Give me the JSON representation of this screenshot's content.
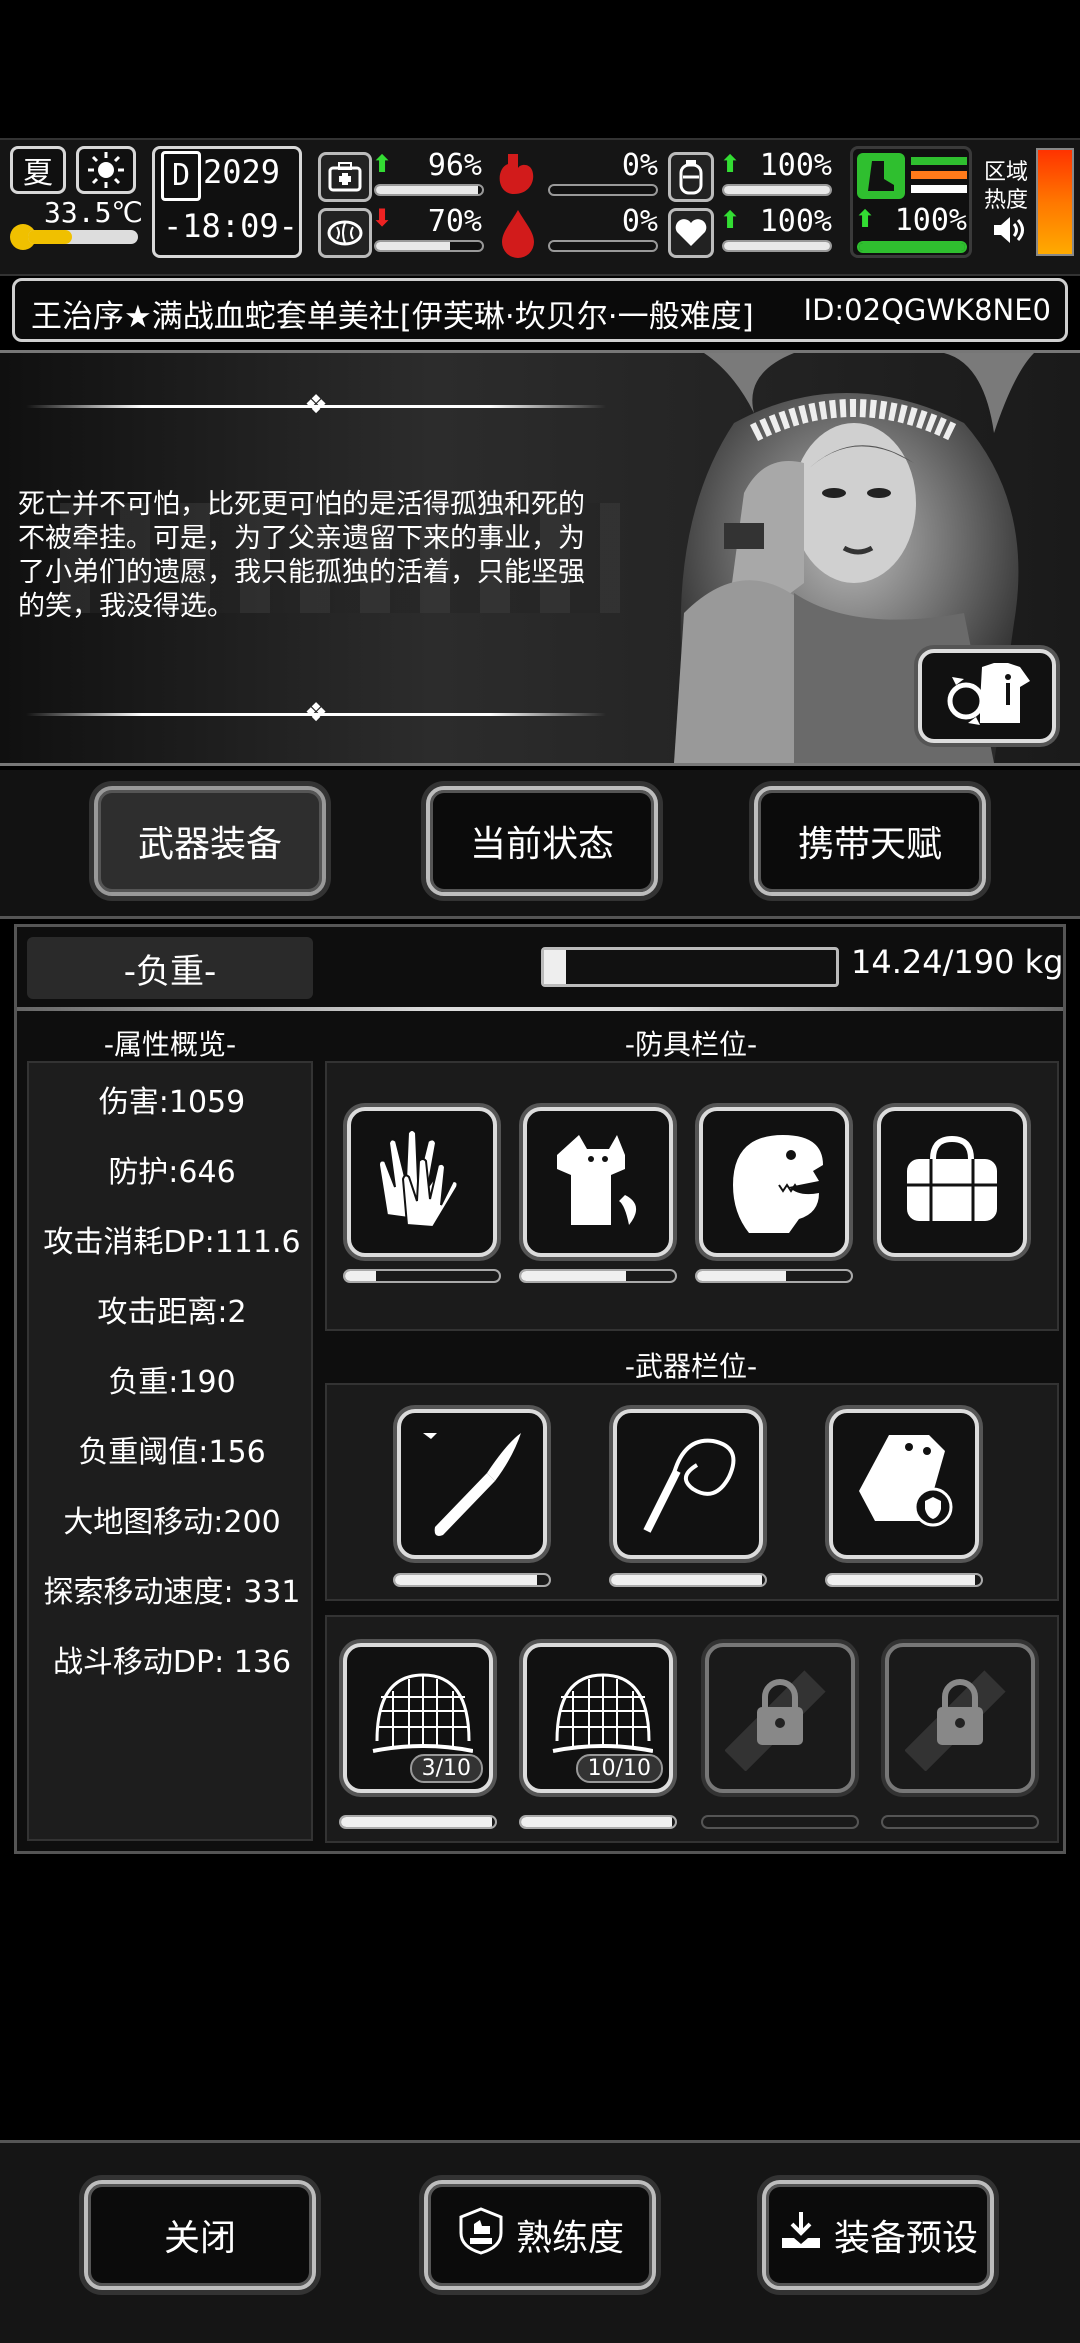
{
  "hud": {
    "season": "夏",
    "temperature": "33.5℃",
    "day_prefix": "D",
    "day": "2029",
    "time": "-18:09-",
    "health": {
      "icon": "medkit-icon",
      "trend": "up",
      "value": "96%",
      "fill": 0.96
    },
    "stomach": {
      "icon": "stomach-icon",
      "value": "0%",
      "fill": 0.0
    },
    "hydration": {
      "icon": "bottle-icon",
      "trend": "up",
      "value": "100%",
      "fill": 1.0
    },
    "brain": {
      "icon": "brain-icon",
      "trend": "down",
      "value": "70%",
      "fill": 0.7
    },
    "blood": {
      "icon": "blood-drop-icon",
      "value": "0%",
      "fill": 0.0
    },
    "mood": {
      "icon": "heart-icon",
      "trend": "up",
      "value": "100%",
      "fill": 1.0
    },
    "stamina": {
      "icon": "boot-icon",
      "trend": "up",
      "value": "100%",
      "fill": 1.0
    },
    "zone_heat_label_1": "区域",
    "zone_heat_label_2": "热度",
    "colors": {
      "up": "#33dd33",
      "down": "#ee2222",
      "heat_top": "#ff3300",
      "heat_bottom": "#ffaa00"
    }
  },
  "title": {
    "text": "王治序★满战血蛇套单美社[伊芙琳·坎贝尔·一般难度]",
    "id": "ID:02QGWK8NE0"
  },
  "story": {
    "quote": "死亡并不可怕，比死更可怕的是活得孤独和死的不被牵挂。可是，为了父亲遗留下来的事业，为了小弟们的遗愿，我只能孤独的活着，只能坚强的笑，我没得选。"
  },
  "tabs": [
    {
      "label": "武器装备",
      "active": true
    },
    {
      "label": "当前状态",
      "active": false
    },
    {
      "label": "携带天赋",
      "active": false
    }
  ],
  "load": {
    "label": "-负重-",
    "value_text": "14.24/190 kg",
    "fill": 0.075
  },
  "attributes": {
    "header": "-属性概览-",
    "items": [
      "伤害:1059",
      "防护:646",
      "攻击消耗DP:111.6",
      "攻击距离:2",
      "负重:190",
      "负重阈值:156",
      "大地图移动:200",
      "探索移动速度: 331",
      "战斗移动DP: 136"
    ]
  },
  "armor": {
    "header": "-防具栏位-",
    "slots": [
      {
        "icon": "gloves-icon",
        "durability": 0.2
      },
      {
        "icon": "fox-hoodie-icon",
        "durability": 0.68
      },
      {
        "icon": "dinosaur-head-icon",
        "durability": 0.58
      },
      {
        "icon": "bag-icon",
        "durability": null
      }
    ]
  },
  "weapons": {
    "header": "-武器栏位-",
    "slots": [
      {
        "icon": "scalpel-icon",
        "durability": 0.92
      },
      {
        "icon": "whip-icon",
        "durability": 0.98
      },
      {
        "icon": "armor-plate-icon",
        "durability": 0.96
      }
    ]
  },
  "consumables": {
    "slots": [
      {
        "icon": "net-trap-icon",
        "count": "3/10",
        "durability": 0.98
      },
      {
        "icon": "net-trap-icon",
        "count": "10/10",
        "durability": 0.98
      },
      {
        "icon": "locked-slot-icon",
        "durability": null
      },
      {
        "icon": "locked-slot-icon",
        "durability": null
      }
    ]
  },
  "bottom": {
    "close": "关闭",
    "proficiency": "熟练度",
    "preset": "装备预设"
  }
}
